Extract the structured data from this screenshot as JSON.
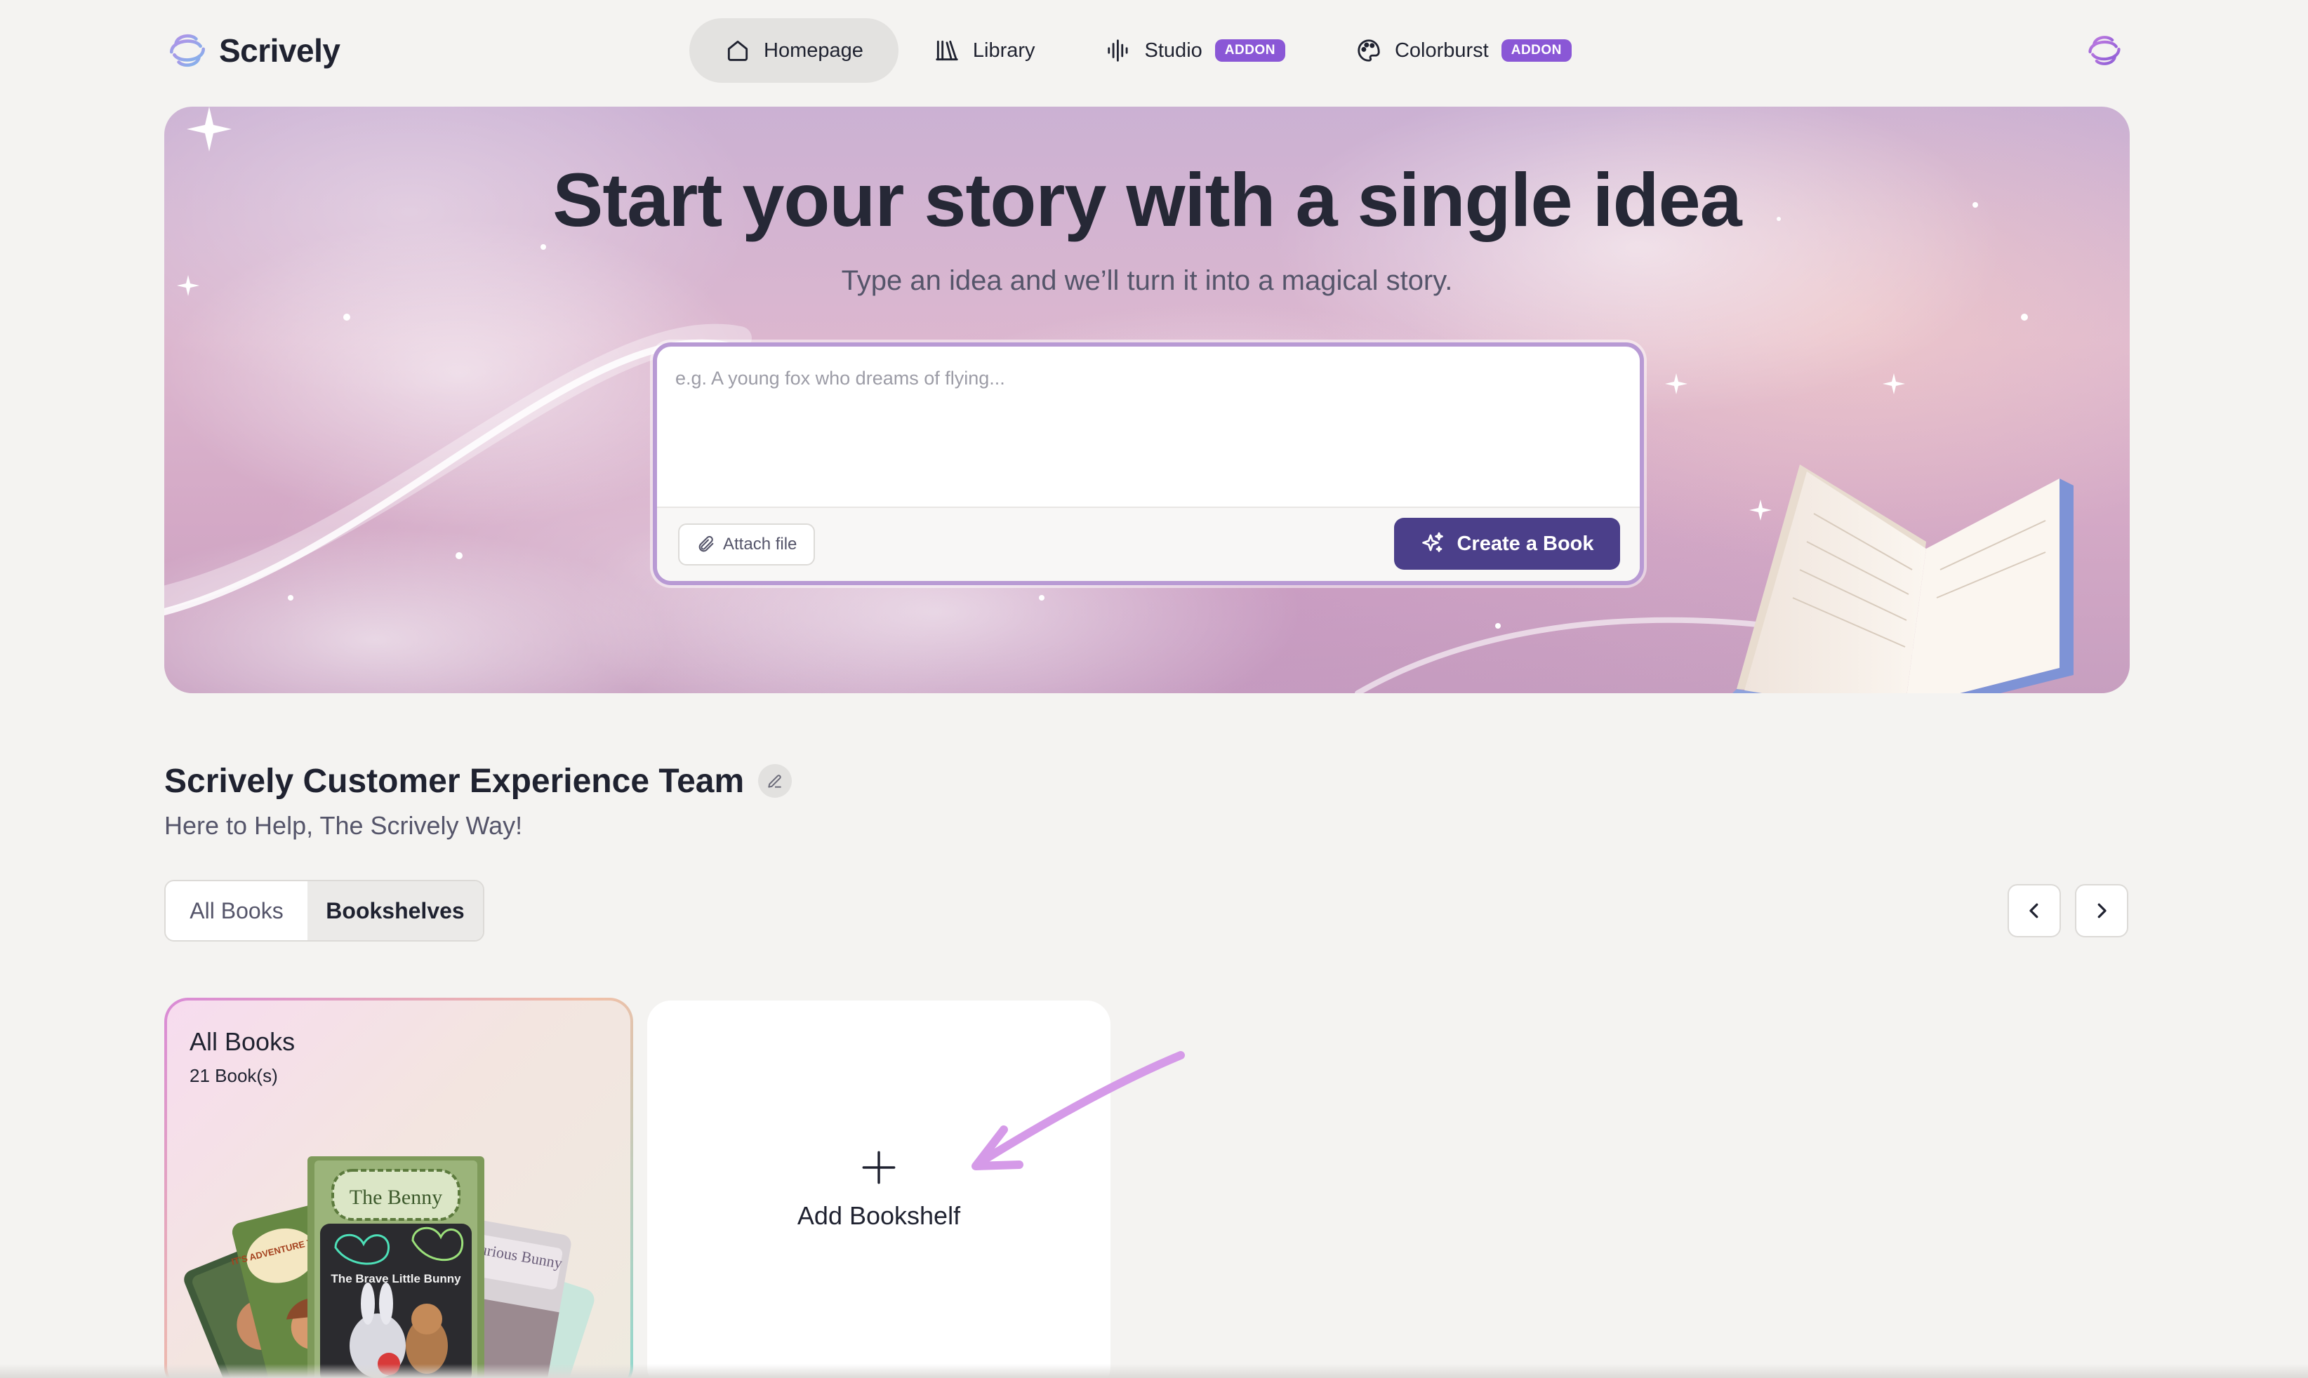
{
  "nav": {
    "brand": "Scrively",
    "tabs": [
      {
        "label": "Homepage",
        "icon": "home-icon",
        "active": true
      },
      {
        "label": "Library",
        "icon": "books-icon",
        "active": false
      },
      {
        "label": "Studio",
        "icon": "audio-wave-icon",
        "badge": "ADDON",
        "active": false
      },
      {
        "label": "Colorburst",
        "icon": "palette-icon",
        "badge": "ADDON",
        "active": false
      }
    ]
  },
  "hero": {
    "title": "Start your story with a single idea",
    "subtitle": "Type an idea and we’ll turn it into a magical story.",
    "input_placeholder": "e.g. A young fox who dreams of flying...",
    "input_value": "",
    "attach_label": "Attach file",
    "create_label": "Create a Book"
  },
  "profile": {
    "name": "Scrively Customer Experience Team",
    "tagline": "Here to Help, The Scrively Way!"
  },
  "view_toggle": {
    "options": [
      "All Books",
      "Bookshelves"
    ],
    "selected": "Bookshelves"
  },
  "shelves": [
    {
      "title": "All Books",
      "count": "21 Book(s)",
      "covers": [
        "IT'S ADVENTURE TIME",
        "The Benny",
        "The Brave Little Bunny",
        "Curious Bunny"
      ]
    }
  ],
  "add_shelf_label": "Add Bookshelf",
  "colors": {
    "accent": "#4b3f8a",
    "badge": "#8a57d6",
    "annotation": "#d59ae8"
  }
}
